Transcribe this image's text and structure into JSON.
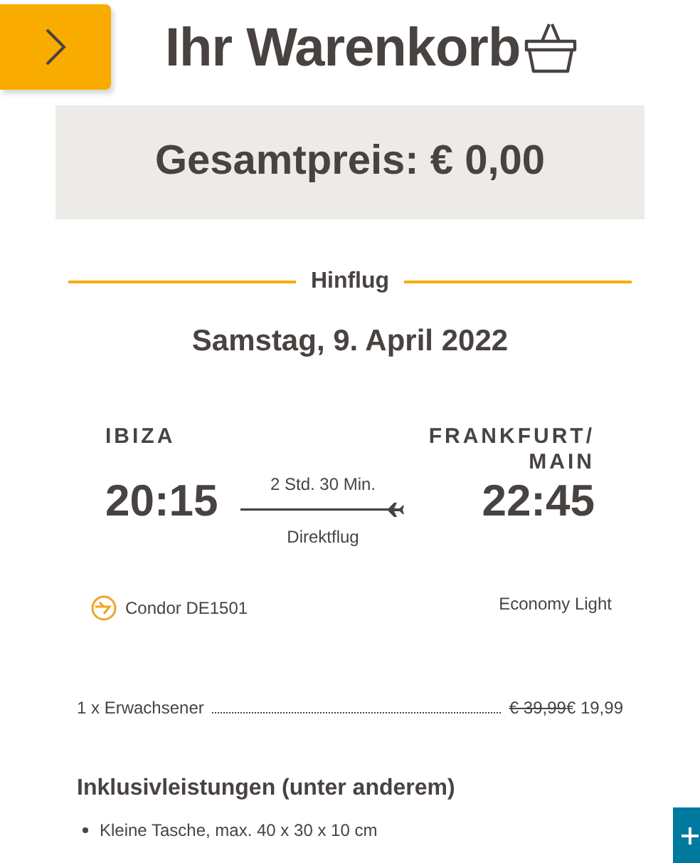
{
  "header": {
    "title": "Ihr Warenkorb"
  },
  "total": {
    "label": "Gesamtpreis: € 0,00"
  },
  "segment": {
    "heading": "Hinflug",
    "date": "Samstag, 9. April 2022",
    "origin": {
      "city": "IBIZA",
      "time": "20:15"
    },
    "destination": {
      "city": "FRANKFURT/ MAIN",
      "time": "22:45"
    },
    "duration": "2 Std. 30 Min.",
    "stops": "Direktflug",
    "airline": "Condor DE1501",
    "fare": "Economy Light"
  },
  "passengers": [
    {
      "label": "1 x Erwachsener",
      "old_price": "€ 39,99",
      "price": "€ 19,99"
    }
  ],
  "inclusions": {
    "heading": "Inklusivleistungen (unter anderem)",
    "items": [
      "Kleine Tasche, max. 40 x 30 x 10 cm"
    ]
  }
}
